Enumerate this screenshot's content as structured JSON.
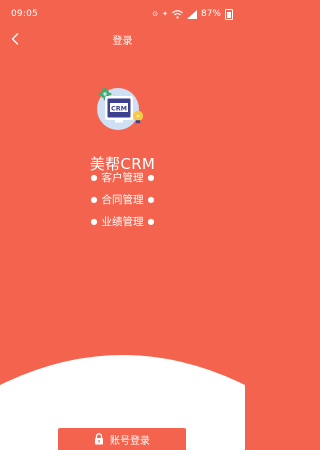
{
  "status_bar": {
    "time": "09:05",
    "battery": "87%"
  },
  "header": {
    "title": "登录"
  },
  "app": {
    "name": "美帮CRM",
    "logo_text": "CRM"
  },
  "features": [
    "客户管理",
    "合同管理",
    "业绩管理"
  ],
  "actions": {
    "login_label": "账号登录"
  },
  "colors": {
    "primary": "#F4634E",
    "white": "#FFFFFF",
    "logo_circle": "#CFE0F5",
    "logo_screen": "#3D3F8F",
    "logo_bulb": "#F6C945",
    "logo_gear": "#3BAF6F"
  },
  "icons": [
    "back-arrow-icon",
    "wifi-icon",
    "signal-icon",
    "battery-icon",
    "lock-icon",
    "gear-icon",
    "lightbulb-icon"
  ]
}
